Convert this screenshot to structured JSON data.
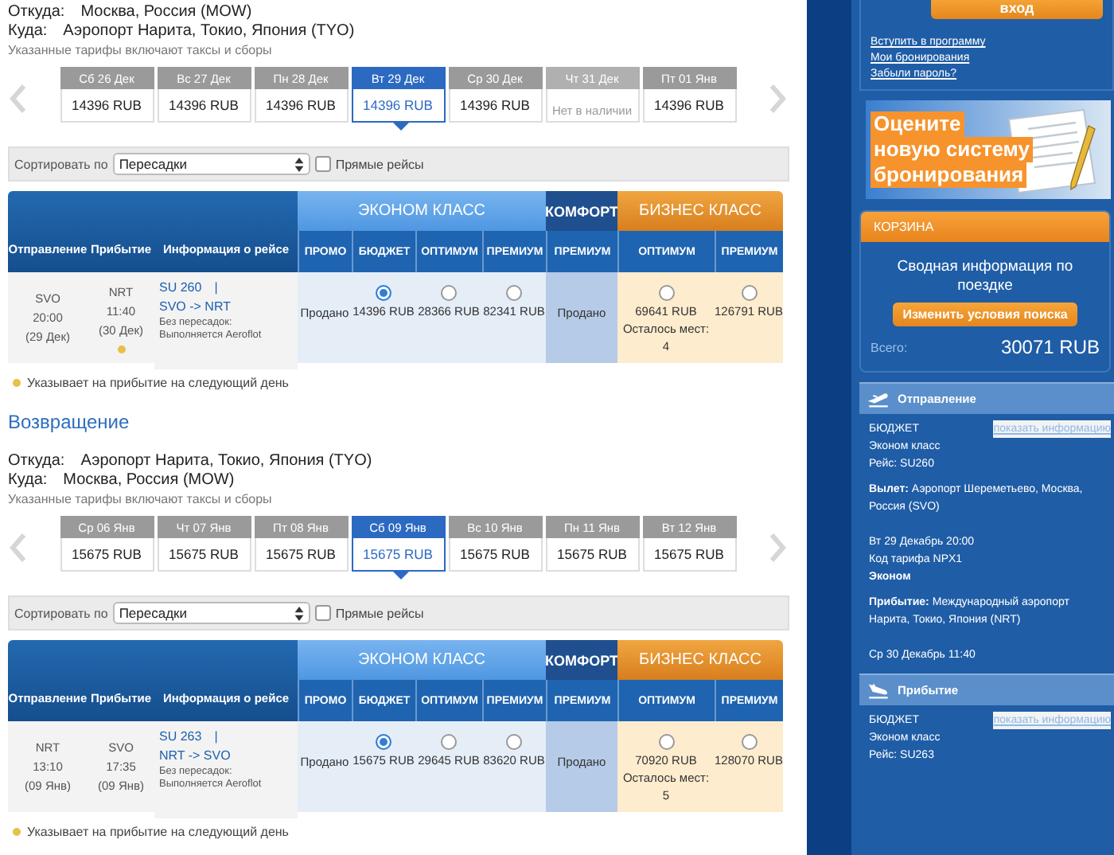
{
  "outbound": {
    "from_label": "Откуда:",
    "from": "Москва, Россия (MOW)",
    "to_label": "Куда:",
    "to": "Аэропорт Нарита, Токио, Япония (TYO)",
    "note": "Указанные тарифы включают таксы и сборы",
    "dates": [
      {
        "label": "Сб 26 Дек",
        "price": "14396 RUB",
        "available": true,
        "selected": false
      },
      {
        "label": "Вс 27 Дек",
        "price": "14396 RUB",
        "available": true,
        "selected": false
      },
      {
        "label": "Пн 28 Дек",
        "price": "14396 RUB",
        "available": true,
        "selected": false
      },
      {
        "label": "Вт 29 Дек",
        "price": "14396 RUB",
        "available": true,
        "selected": true
      },
      {
        "label": "Ср 30 Дек",
        "price": "14396 RUB",
        "available": true,
        "selected": false
      },
      {
        "label": "Чт 31 Дек",
        "price": "Нет в наличии",
        "available": false,
        "selected": false
      },
      {
        "label": "Пт 01 Янв",
        "price": "14396 RUB",
        "available": true,
        "selected": false
      }
    ],
    "sort_label": "Сортировать по",
    "sort_value": "Пересадки",
    "direct": {
      "label": "Прямые рейсы",
      "checked": false
    },
    "row": {
      "dep": {
        "airport": "SVO",
        "time": "20:00",
        "date": "(29 Дек)"
      },
      "arr": {
        "airport": "NRT",
        "time": "11:40",
        "date": "(30 Дек)",
        "next_day": true
      },
      "flight": "SU 260",
      "sep": "|",
      "route": "SVO -> NRT",
      "details": "Без пересадок: Выполняется Aeroflot",
      "cells": [
        {
          "kind": "sold",
          "text": "Продано"
        },
        {
          "kind": "fare",
          "price": "14396 RUB",
          "selected": true
        },
        {
          "kind": "fare",
          "price": "28366 RUB",
          "selected": false
        },
        {
          "kind": "fare",
          "price": "82341 RUB",
          "selected": false
        },
        {
          "kind": "sold",
          "text": "Продано"
        },
        {
          "kind": "fare",
          "price": "69641 RUB",
          "selected": false,
          "seats_label": "Осталось мест:",
          "seats": "4"
        },
        {
          "kind": "fare",
          "price": "126791 RUB",
          "selected": false
        }
      ]
    },
    "footnote": "Указывает на прибытие на следующий день",
    "table_header": {
      "columns": [
        "Отправление",
        "Прибытие",
        "Информация о рейсе"
      ],
      "groups": [
        {
          "kind": "economy",
          "name": "ЭКОНОМ КЛАСС",
          "fares": [
            "ПРОМО",
            "БЮДЖЕТ",
            "ОПТИМУМ",
            "ПРЕМИУМ"
          ]
        },
        {
          "kind": "comfort",
          "name": "КОМФОРТ",
          "fares": [
            "ПРЕМИУМ"
          ]
        },
        {
          "kind": "business",
          "name": "БИЗНЕС КЛАСС",
          "fares": [
            "ОПТИМУМ",
            "ПРЕМИУМ"
          ]
        }
      ]
    }
  },
  "return_title": "Возвращение",
  "inbound": {
    "from_label": "Откуда:",
    "from": "Аэропорт Нарита, Токио, Япония (TYO)",
    "to_label": "Куда:",
    "to": "Москва, Россия (MOW)",
    "note": "Указанные тарифы включают таксы и сборы",
    "dates": [
      {
        "label": "Ср 06 Янв",
        "price": "15675 RUB",
        "available": true,
        "selected": false
      },
      {
        "label": "Чт 07 Янв",
        "price": "15675 RUB",
        "available": true,
        "selected": false
      },
      {
        "label": "Пт 08 Янв",
        "price": "15675 RUB",
        "available": true,
        "selected": false
      },
      {
        "label": "Сб 09 Янв",
        "price": "15675 RUB",
        "available": true,
        "selected": true
      },
      {
        "label": "Вс 10 Янв",
        "price": "15675 RUB",
        "available": true,
        "selected": false
      },
      {
        "label": "Пн 11 Янв",
        "price": "15675 RUB",
        "available": true,
        "selected": false
      },
      {
        "label": "Вт 12 Янв",
        "price": "15675 RUB",
        "available": true,
        "selected": false
      }
    ],
    "sort_label": "Сортировать по",
    "sort_value": "Пересадки",
    "direct": {
      "label": "Прямые рейсы",
      "checked": false
    },
    "row": {
      "dep": {
        "airport": "NRT",
        "time": "13:10",
        "date": "(09 Янв)"
      },
      "arr": {
        "airport": "SVO",
        "time": "17:35",
        "date": "(09 Янв)",
        "next_day": false
      },
      "flight": "SU 263",
      "sep": "|",
      "route": "NRT -> SVO",
      "details": "Без пересадок: Выполняется Aeroflot",
      "cells": [
        {
          "kind": "sold",
          "text": "Продано"
        },
        {
          "kind": "fare",
          "price": "15675 RUB",
          "selected": true
        },
        {
          "kind": "fare",
          "price": "29645 RUB",
          "selected": false
        },
        {
          "kind": "fare",
          "price": "83620 RUB",
          "selected": false
        },
        {
          "kind": "sold",
          "text": "Продано"
        },
        {
          "kind": "fare",
          "price": "70920 RUB",
          "selected": false,
          "seats_label": "Осталось мест:",
          "seats": "5"
        },
        {
          "kind": "fare",
          "price": "128070 RUB",
          "selected": false
        }
      ]
    },
    "footnote": "Указывает на прибытие на следующий день",
    "table_header": {
      "columns": [
        "Отправление",
        "Прибытие",
        "Информация о рейсе"
      ],
      "groups": [
        {
          "kind": "economy",
          "name": "ЭКОНОМ КЛАСС",
          "fares": [
            "ПРОМО",
            "БЮДЖЕТ",
            "ОПТИМУМ",
            "ПРЕМИУМ"
          ]
        },
        {
          "kind": "comfort",
          "name": "КОМФОРТ",
          "fares": [
            "ПРЕМИУМ"
          ]
        },
        {
          "kind": "business",
          "name": "БИЗНЕС КЛАСС",
          "fares": [
            "ОПТИМУМ",
            "ПРЕМИУМ"
          ]
        }
      ]
    }
  },
  "sidebar": {
    "login_button": "вход",
    "links": [
      "Вступить в программу",
      "Мои бронирования",
      "Забыли пароль?"
    ],
    "banner": [
      "Оцените",
      "новую систему",
      "бронирования"
    ],
    "cart": {
      "title": "КОРЗИНА",
      "summary": "Сводная информация по поездке",
      "button": "Изменить условия поиска",
      "total_label": "Всего:",
      "total": "30071 RUB"
    },
    "segments": [
      {
        "kind": "departure",
        "title": "Отправление",
        "fare": "БЮДЖЕТ",
        "link": "показать информацию",
        "cabin_class": "Эконом класс",
        "flight": "Рейс: SU260",
        "dep": "**Вылет:** Аэропорт Шереметьево, Москва, Россия (SVO)",
        "dep_time": "Вт 29 Декабрь 20:00",
        "code": "Код тарифа NPX1",
        "cabin": "Эконом",
        "arr": "**Прибытие:** Международный аэропорт Нарита, Токио, Япония (NRT)",
        "arr_time": "Ср 30 Декабрь 11:40"
      },
      {
        "kind": "arrival",
        "title": "Прибытие",
        "fare": "БЮДЖЕТ",
        "link": "показать информацию",
        "cabin_class": "Эконом класс",
        "flight": "Рейс: SU263"
      }
    ]
  }
}
